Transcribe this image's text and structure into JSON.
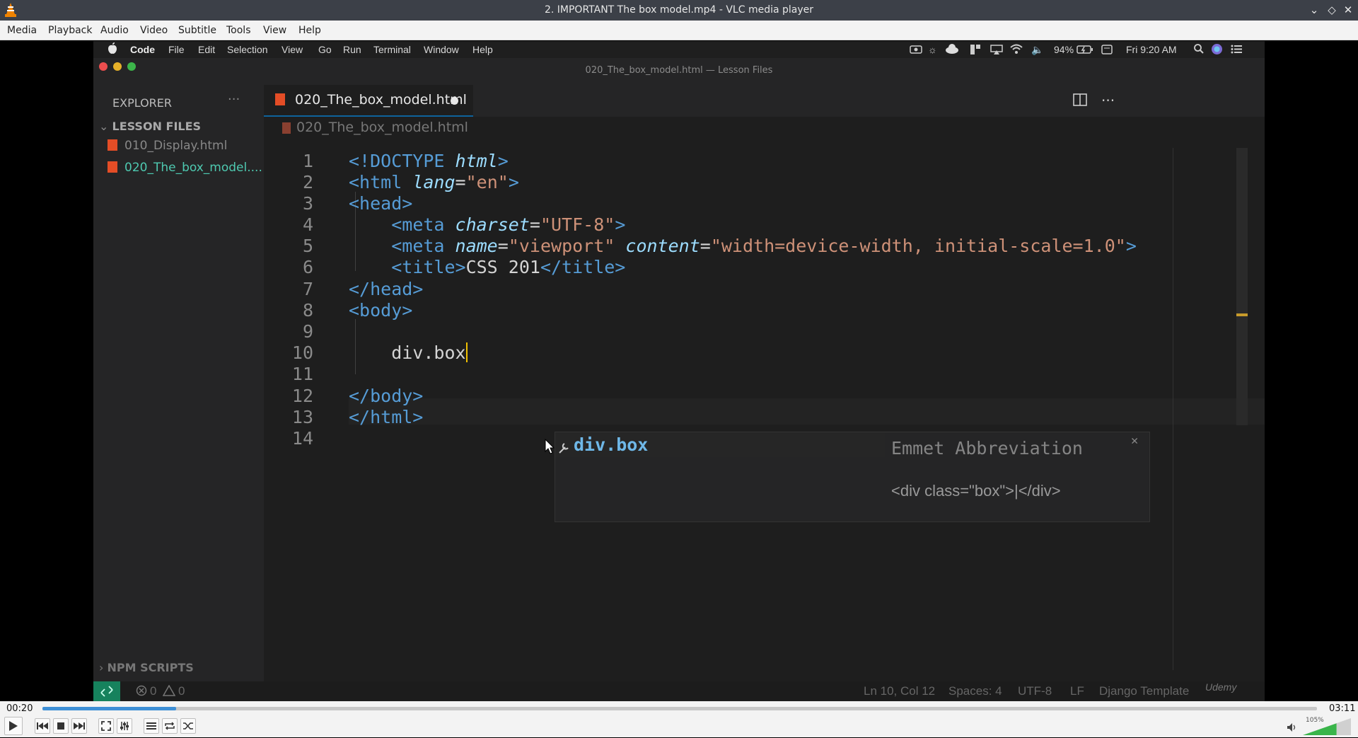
{
  "window": {
    "title": "2. IMPORTANT The box model.mp4 - VLC media player"
  },
  "menu": [
    "Media",
    "Playback",
    "Audio",
    "Video",
    "Subtitle",
    "Tools",
    "View",
    "Help"
  ],
  "mac_menubar": {
    "items": [
      "Code",
      "File",
      "Edit",
      "Selection",
      "View",
      "Go",
      "Run",
      "Terminal",
      "Window",
      "Help"
    ],
    "battery": "94%",
    "clock": "Fri 9:20 AM"
  },
  "vscode": {
    "window_title": "020_The_box_model.html — Lesson Files",
    "explorer_title": "EXPLORER",
    "folder": "LESSON FILES",
    "files": [
      "010_Display.html",
      "020_The_box_model...."
    ],
    "npm_scripts": "NPM SCRIPTS",
    "tab": "020_The_box_model.html",
    "breadcrumb": "020_The_box_model.html",
    "line_numbers": [
      "1",
      "2",
      "3",
      "4",
      "5",
      "6",
      "7",
      "8",
      "9",
      "10",
      "11",
      "12",
      "13",
      "14"
    ],
    "suggestion": "div.box",
    "emmet_title": "Emmet Abbreviation",
    "emmet_preview": "<div class=\"box\">|</div>",
    "status": {
      "errors": "0",
      "warnings": "0",
      "position": "Ln 10, Col 12",
      "spaces": "Spaces: 4",
      "encoding": "UTF-8",
      "eol": "LF",
      "language": "Django Template"
    },
    "watermark": "Udemy"
  },
  "player": {
    "elapsed": "00:20",
    "total": "03:11",
    "progress_fraction": 0.105,
    "volume": "105%",
    "volume_fraction": 0.7
  },
  "colors": {
    "vlc_orange": "#f08300",
    "progress": "#3d8fd6",
    "volume": "#39b54a"
  }
}
